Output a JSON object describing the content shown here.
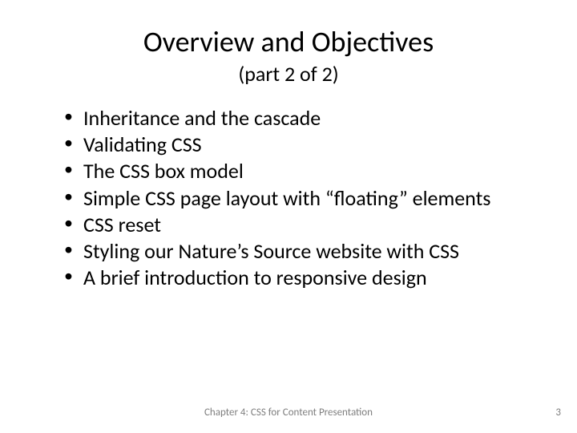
{
  "title": "Overview and Objectives",
  "subtitle": "(part 2 of 2)",
  "bullets": [
    "Inheritance and the cascade",
    "Validating CSS",
    "The CSS box model",
    "Simple CSS page layout with “floating” elements",
    "CSS reset",
    "Styling our Nature’s Source website with CSS",
    "A brief introduction to responsive design"
  ],
  "footer": "Chapter 4: CSS for Content Presentation",
  "page_number": "3"
}
